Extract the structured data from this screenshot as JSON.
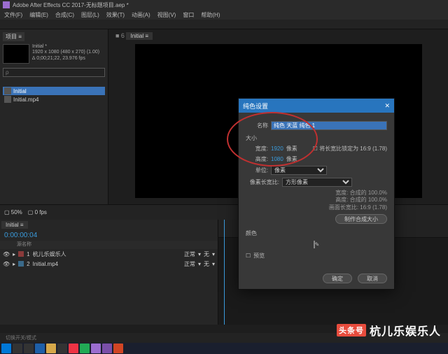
{
  "titlebar": {
    "app": "Adobe After Effects CC 2017",
    "project": "无标题项目.aep *"
  },
  "menu": [
    "文件(F)",
    "编辑(E)",
    "合成(C)",
    "图层(L)",
    "效果(T)",
    "动画(A)",
    "视图(V)",
    "窗口",
    "帮助(H)"
  ],
  "project": {
    "tab": "项目 ≡",
    "comp": {
      "name": "Initial *",
      "size": "1920 x 1080 (480 x 270) (1.00)",
      "duration": "∆ 0;00;21;22, 23.976 fps"
    },
    "search_placeholder": "ρ",
    "items": [
      {
        "name": "Initial",
        "selected": true
      },
      {
        "name": "Initial.mp4",
        "selected": false
      }
    ]
  },
  "viewer": {
    "tab": "Initial ≡"
  },
  "timeline": {
    "tab": "Initial ≡",
    "timecode": "0:00:00:04",
    "col_header": "源名称",
    "layers": [
      {
        "num": "1",
        "name": "杭儿乐娱乐人",
        "modes": [
          "正常",
          "无"
        ]
      },
      {
        "num": "2",
        "name": "Initial.mp4",
        "modes": [
          "正常",
          "无"
        ]
      }
    ],
    "footer": "切换开关/模式"
  },
  "dialog": {
    "title": "纯色设置",
    "name_label": "名称",
    "name_value": "纯色 天蓝 纯色 1",
    "size_group": "大小",
    "width_label": "宽度:",
    "width_value": "1920",
    "px": "像素",
    "height_label": "高度:",
    "height_value": "1080",
    "lock_label": "将长宽比锁定为 16:9 (1.78)",
    "unit_label": "单位:",
    "unit_value": "像素",
    "par_label": "像素长宽比:",
    "par_value": "方形像素",
    "info_w": "宽度: 合成的 100.0%",
    "info_h": "高度: 合成的 100.0%",
    "info_fa": "画面长宽比: 16:9 (1.78)",
    "make_btn": "制作合成大小",
    "color_label": "颜色",
    "preview_label": "预览",
    "ok": "确定",
    "cancel": "取消"
  },
  "watermark": {
    "prefix": "头条号",
    "author": "杭儿乐娱乐人"
  },
  "taskbar_icons": [
    "windows",
    "search",
    "task",
    "edge",
    "folder",
    "store",
    "music",
    "mail",
    "ae",
    "pr",
    "ppt"
  ],
  "colors": {
    "accent": "#2875be",
    "link": "#3a9bdc"
  }
}
